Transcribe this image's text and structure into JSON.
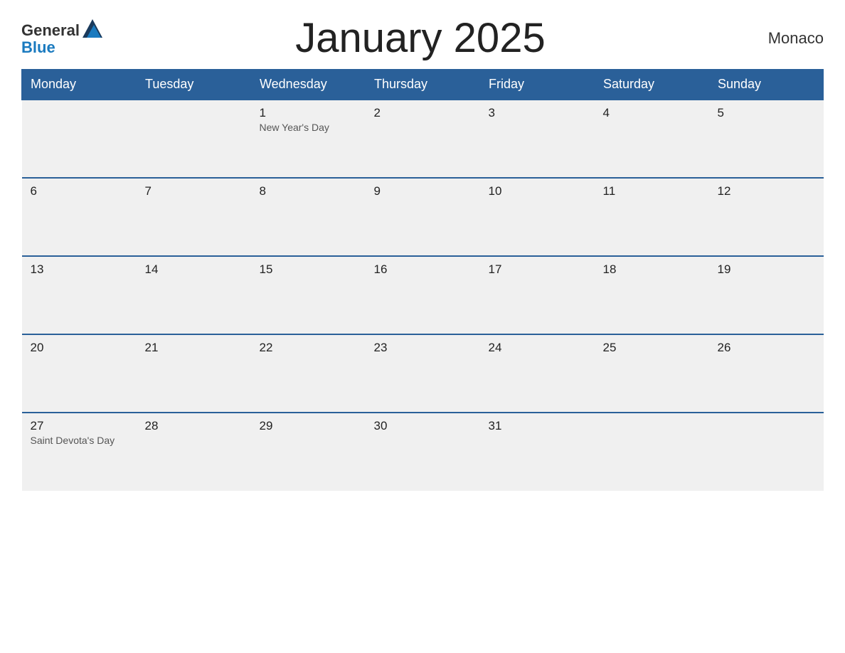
{
  "header": {
    "title": "January 2025",
    "country": "Monaco",
    "logo": {
      "line1": "General",
      "line2": "Blue"
    }
  },
  "calendar": {
    "days_of_week": [
      "Monday",
      "Tuesday",
      "Wednesday",
      "Thursday",
      "Friday",
      "Saturday",
      "Sunday"
    ],
    "weeks": [
      [
        {
          "date": "",
          "holiday": ""
        },
        {
          "date": "",
          "holiday": ""
        },
        {
          "date": "1",
          "holiday": "New Year's Day"
        },
        {
          "date": "2",
          "holiday": ""
        },
        {
          "date": "3",
          "holiday": ""
        },
        {
          "date": "4",
          "holiday": ""
        },
        {
          "date": "5",
          "holiday": ""
        }
      ],
      [
        {
          "date": "6",
          "holiday": ""
        },
        {
          "date": "7",
          "holiday": ""
        },
        {
          "date": "8",
          "holiday": ""
        },
        {
          "date": "9",
          "holiday": ""
        },
        {
          "date": "10",
          "holiday": ""
        },
        {
          "date": "11",
          "holiday": ""
        },
        {
          "date": "12",
          "holiday": ""
        }
      ],
      [
        {
          "date": "13",
          "holiday": ""
        },
        {
          "date": "14",
          "holiday": ""
        },
        {
          "date": "15",
          "holiday": ""
        },
        {
          "date": "16",
          "holiday": ""
        },
        {
          "date": "17",
          "holiday": ""
        },
        {
          "date": "18",
          "holiday": ""
        },
        {
          "date": "19",
          "holiday": ""
        }
      ],
      [
        {
          "date": "20",
          "holiday": ""
        },
        {
          "date": "21",
          "holiday": ""
        },
        {
          "date": "22",
          "holiday": ""
        },
        {
          "date": "23",
          "holiday": ""
        },
        {
          "date": "24",
          "holiday": ""
        },
        {
          "date": "25",
          "holiday": ""
        },
        {
          "date": "26",
          "holiday": ""
        }
      ],
      [
        {
          "date": "27",
          "holiday": "Saint Devota's Day"
        },
        {
          "date": "28",
          "holiday": ""
        },
        {
          "date": "29",
          "holiday": ""
        },
        {
          "date": "30",
          "holiday": ""
        },
        {
          "date": "31",
          "holiday": ""
        },
        {
          "date": "",
          "holiday": ""
        },
        {
          "date": "",
          "holiday": ""
        }
      ]
    ]
  }
}
